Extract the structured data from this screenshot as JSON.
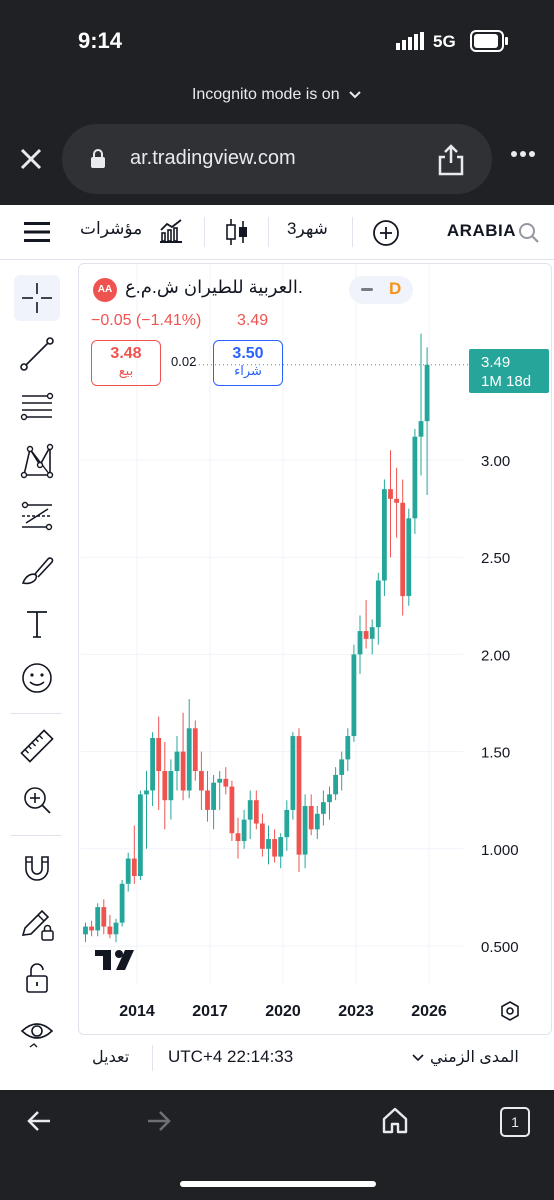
{
  "status_bar": {
    "time": "9:14",
    "network": "5G"
  },
  "browser": {
    "incognito_text": "Incognito mode is on",
    "url": "ar.tradingview.com"
  },
  "toolbar": {
    "symbol": "ARABIA",
    "interval": "3شهر",
    "indicators_label": "مؤشرات"
  },
  "instrument": {
    "name": "العربية للطيران ش.م.ع.",
    "badge": "AA",
    "timeframe_badge": "D",
    "change": "−0.05 (−1.41%)",
    "price": "3.49",
    "sell_price": "3.48",
    "sell_label": "بيع",
    "spread": "0.02",
    "buy_price": "3.50",
    "buy_label": "شراء",
    "current_label_price": "3.49",
    "current_label_countdown": "1M 18d"
  },
  "bottom_bar": {
    "range_label": "المدى الزمني",
    "clock": "UTC+4 22:14:33",
    "edit_label": "تعديل"
  },
  "colors": {
    "up": "#26a69a",
    "down": "#ef5350",
    "buy": "#2962ff",
    "grid": "#f0f3fa",
    "text": "#131722"
  },
  "chart_data": {
    "type": "candlestick",
    "y_ticks": [
      "3.00",
      "2.50",
      "2.00",
      "1.50",
      "1.000",
      "0.500"
    ],
    "x_ticks": [
      "2014",
      "2017",
      "2020",
      "2023",
      "2026"
    ],
    "ylim": [
      0.27,
      3.7
    ],
    "candles": [
      [
        0.56,
        0.62,
        0.52,
        0.6
      ],
      [
        0.6,
        0.63,
        0.55,
        0.58
      ],
      [
        0.58,
        0.72,
        0.55,
        0.7
      ],
      [
        0.7,
        0.74,
        0.56,
        0.6
      ],
      [
        0.6,
        0.66,
        0.54,
        0.56
      ],
      [
        0.56,
        0.64,
        0.52,
        0.62
      ],
      [
        0.62,
        0.84,
        0.6,
        0.82
      ],
      [
        0.82,
        0.98,
        0.78,
        0.95
      ],
      [
        0.95,
        1.12,
        0.82,
        0.86
      ],
      [
        0.86,
        1.3,
        0.84,
        1.28
      ],
      [
        1.28,
        1.4,
        1.0,
        1.3
      ],
      [
        1.3,
        1.6,
        1.22,
        1.57
      ],
      [
        1.57,
        1.68,
        1.2,
        1.4
      ],
      [
        1.4,
        1.55,
        1.1,
        1.25
      ],
      [
        1.25,
        1.46,
        1.15,
        1.4
      ],
      [
        1.4,
        1.58,
        1.3,
        1.5
      ],
      [
        1.5,
        1.7,
        1.25,
        1.3
      ],
      [
        1.3,
        1.77,
        1.26,
        1.62
      ],
      [
        1.62,
        1.66,
        1.35,
        1.4
      ],
      [
        1.4,
        1.5,
        1.2,
        1.3
      ],
      [
        1.3,
        1.4,
        1.14,
        1.2
      ],
      [
        1.2,
        1.38,
        1.1,
        1.34
      ],
      [
        1.34,
        1.4,
        1.2,
        1.36
      ],
      [
        1.36,
        1.42,
        1.28,
        1.32
      ],
      [
        1.32,
        1.35,
        1.04,
        1.08
      ],
      [
        1.08,
        1.16,
        0.95,
        1.04
      ],
      [
        1.04,
        1.2,
        1.0,
        1.15
      ],
      [
        1.15,
        1.3,
        1.05,
        1.25
      ],
      [
        1.25,
        1.3,
        1.1,
        1.13
      ],
      [
        1.13,
        1.18,
        0.96,
        1.0
      ],
      [
        1.0,
        1.12,
        0.92,
        1.05
      ],
      [
        1.05,
        1.1,
        0.93,
        0.96
      ],
      [
        0.96,
        1.08,
        0.9,
        1.06
      ],
      [
        1.06,
        1.25,
        0.99,
        1.2
      ],
      [
        1.2,
        1.6,
        1.15,
        1.58
      ],
      [
        1.58,
        1.62,
        0.88,
        0.97
      ],
      [
        0.97,
        1.28,
        0.9,
        1.22
      ],
      [
        1.22,
        1.28,
        1.07,
        1.1
      ],
      [
        1.1,
        1.22,
        1.05,
        1.18
      ],
      [
        1.18,
        1.3,
        1.12,
        1.24
      ],
      [
        1.24,
        1.32,
        1.15,
        1.28
      ],
      [
        1.28,
        1.42,
        1.25,
        1.38
      ],
      [
        1.38,
        1.5,
        1.3,
        1.46
      ],
      [
        1.46,
        1.62,
        1.4,
        1.58
      ],
      [
        1.58,
        2.05,
        1.55,
        2.0
      ],
      [
        2.0,
        2.2,
        1.9,
        2.12
      ],
      [
        2.12,
        2.28,
        2.03,
        2.08
      ],
      [
        2.08,
        2.18,
        2.0,
        2.14
      ],
      [
        2.14,
        2.42,
        2.05,
        2.38
      ],
      [
        2.38,
        2.9,
        2.3,
        2.85
      ],
      [
        2.85,
        3.05,
        2.5,
        2.8
      ],
      [
        2.8,
        2.96,
        2.6,
        2.78
      ],
      [
        2.78,
        2.9,
        2.2,
        2.3
      ],
      [
        2.3,
        2.75,
        2.25,
        2.7
      ],
      [
        2.7,
        3.16,
        2.62,
        3.12
      ],
      [
        3.12,
        3.65,
        2.92,
        3.2
      ],
      [
        3.2,
        3.58,
        2.82,
        3.49
      ]
    ]
  }
}
